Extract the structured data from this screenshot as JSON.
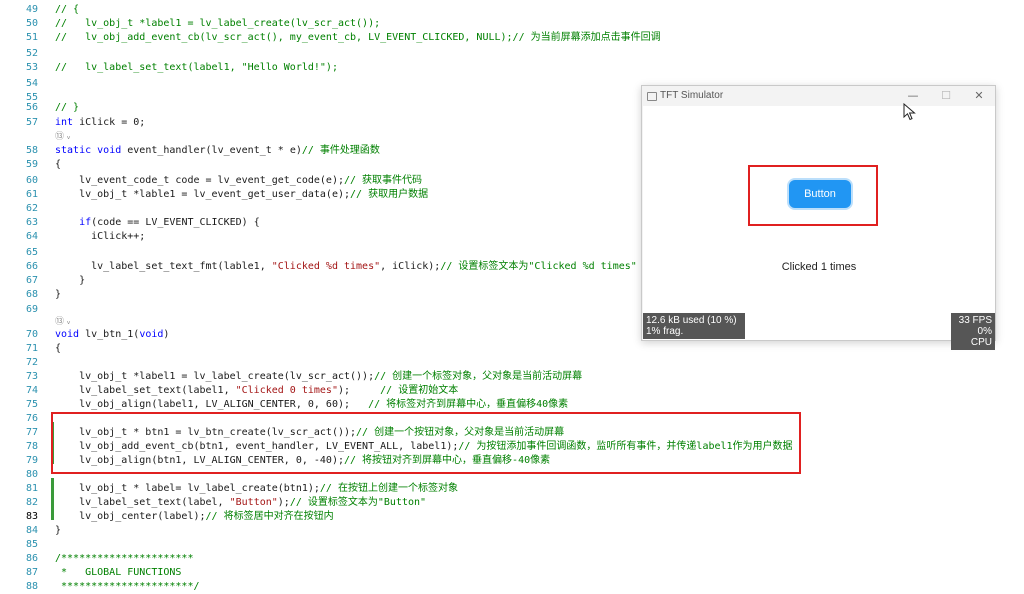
{
  "code_lines": [
    {
      "num": "49",
      "t": [
        [
          "cm",
          "// {"
        ]
      ]
    },
    {
      "num": "50",
      "t": [
        [
          "cm",
          "//   lv_obj_t *label1 = lv_label_create(lv_scr_act());"
        ]
      ]
    },
    {
      "num": "51",
      "t": [
        [
          "cm",
          "//   lv_obj_add_event_cb(lv_scr_act(), my_event_cb, LV_EVENT_CLICKED, NULL);// 为当前屏幕添加点击事件回调"
        ]
      ]
    },
    {
      "num": "52",
      "t": []
    },
    {
      "num": "53",
      "t": [
        [
          "cm",
          "//   lv_label_set_text(label1, \"Hello World!\");"
        ]
      ]
    },
    {
      "num": "54",
      "t": []
    },
    {
      "num": "55",
      "t": []
    },
    {
      "num": "56",
      "t": [
        [
          "cm",
          "// }"
        ]
      ]
    },
    {
      "num": "57",
      "t": [
        [
          "kw",
          "int"
        ],
        [
          "tx",
          " iClick = 0;"
        ]
      ]
    },
    {
      "num": "",
      "hint": "⑬ ᵥ"
    },
    {
      "num": "58",
      "t": [
        [
          "kw",
          "static"
        ],
        [
          "tx",
          " "
        ],
        [
          "kw",
          "void"
        ],
        [
          "tx",
          " event_handler(lv_event_t * e)"
        ],
        [
          "cm",
          "// 事件处理函数"
        ]
      ]
    },
    {
      "num": "59",
      "t": [
        [
          "tx",
          "{"
        ]
      ]
    },
    {
      "num": "60",
      "t": [
        [
          "tx",
          "    lv_event_code_t code = lv_event_get_code(e);"
        ],
        [
          "cm",
          "// 获取事件代码"
        ]
      ]
    },
    {
      "num": "61",
      "t": [
        [
          "tx",
          "    lv_obj_t *lable1 = lv_event_get_user_data(e);"
        ],
        [
          "cm",
          "// 获取用户数据"
        ]
      ]
    },
    {
      "num": "62",
      "t": []
    },
    {
      "num": "63",
      "t": [
        [
          "tx",
          "    "
        ],
        [
          "kw",
          "if"
        ],
        [
          "tx",
          "(code == LV_EVENT_CLICKED) {"
        ]
      ]
    },
    {
      "num": "64",
      "t": [
        [
          "tx",
          "      iClick++;"
        ]
      ]
    },
    {
      "num": "65",
      "t": []
    },
    {
      "num": "66",
      "t": [
        [
          "tx",
          "      lv_label_set_text_fmt(lable1, "
        ],
        [
          "st",
          "\"Clicked %d times\""
        ],
        [
          "tx",
          ", iClick);"
        ],
        [
          "cm",
          "// 设置标签文本为\"Clicked %d times\""
        ]
      ]
    },
    {
      "num": "67",
      "t": [
        [
          "tx",
          "    }"
        ]
      ]
    },
    {
      "num": "68",
      "t": [
        [
          "tx",
          "}"
        ]
      ]
    },
    {
      "num": "69",
      "t": []
    },
    {
      "num": "",
      "hint": "⑬ ᵥ"
    },
    {
      "num": "70",
      "t": [
        [
          "kw",
          "void"
        ],
        [
          "tx",
          " lv_btn_1("
        ],
        [
          "kw",
          "void"
        ],
        [
          "tx",
          ")"
        ]
      ]
    },
    {
      "num": "71",
      "t": [
        [
          "tx",
          "{"
        ]
      ]
    },
    {
      "num": "72",
      "t": []
    },
    {
      "num": "73",
      "t": [
        [
          "tx",
          "    lv_obj_t *label1 = lv_label_create(lv_scr_act());"
        ],
        [
          "cm",
          "// 创建一个标签对象，父对象是当前活动屏幕"
        ]
      ]
    },
    {
      "num": "74",
      "t": [
        [
          "tx",
          "    lv_label_set_text(label1, "
        ],
        [
          "st",
          "\"Clicked 0 times\""
        ],
        [
          "tx",
          ");     "
        ],
        [
          "cm",
          "// 设置初始文本"
        ]
      ]
    },
    {
      "num": "75",
      "t": [
        [
          "tx",
          "    lv_obj_align(label1, LV_ALIGN_CENTER, 0, 60);   "
        ],
        [
          "cm",
          "// 将标签对齐到屏幕中心，垂直偏移40像素"
        ]
      ]
    },
    {
      "num": "76",
      "t": []
    },
    {
      "num": "77",
      "t": [
        [
          "tx",
          "    lv_obj_t * btn1 = lv_btn_create(lv_scr_act());"
        ],
        [
          "cm",
          "// 创建一个按钮对象，父对象是当前活动屏幕"
        ]
      ]
    },
    {
      "num": "78",
      "t": [
        [
          "tx",
          "    lv_obj_add_event_cb(btn1, event_handler, LV_EVENT_ALL, label1);"
        ],
        [
          "cm",
          "// 为按钮添加事件回调函数，监听所有事件，并传递label1作为用户数据"
        ]
      ]
    },
    {
      "num": "79",
      "t": [
        [
          "tx",
          "    lv_obj_align(btn1, LV_ALIGN_CENTER, 0, -40);"
        ],
        [
          "cm",
          "// 将按钮对齐到屏幕中心，垂直偏移-40像素"
        ]
      ]
    },
    {
      "num": "80",
      "t": []
    },
    {
      "num": "81",
      "t": [
        [
          "tx",
          "    lv_obj_t * label= lv_label_create(btn1);"
        ],
        [
          "cm",
          "// 在按钮上创建一个标签对象"
        ]
      ]
    },
    {
      "num": "82",
      "t": [
        [
          "tx",
          "    lv_label_set_text(label, "
        ],
        [
          "st",
          "\"Button\""
        ],
        [
          "tx",
          ");"
        ],
        [
          "cm",
          "// 设置标签文本为\"Button\""
        ]
      ]
    },
    {
      "num": "83",
      "t": [
        [
          "tx",
          "    lv_obj_center(label);"
        ],
        [
          "cm",
          "// 将标签居中对齐在按钮内"
        ]
      ]
    },
    {
      "num": "84",
      "t": [
        [
          "tx",
          "}"
        ]
      ]
    },
    {
      "num": "85",
      "t": []
    },
    {
      "num": "86",
      "t": [
        [
          "cm",
          "/**********************"
        ]
      ]
    },
    {
      "num": "87",
      "t": [
        [
          "cm",
          " *   GLOBAL FUNCTIONS"
        ]
      ]
    },
    {
      "num": "88",
      "t": [
        [
          "cm",
          " **********************/"
        ]
      ]
    }
  ],
  "active_line": "83",
  "simulator": {
    "title": "TFT Simulator",
    "minimize": "—",
    "maximize": "☐",
    "close": "✕",
    "button_label": "Button",
    "status_label": "Clicked 1 times",
    "memory_line1": "12.6 kB used (10 %)",
    "memory_line2": "1% frag.",
    "perf_line1": "33 FPS",
    "perf_line2": "0% CPU"
  },
  "colors": {
    "highlight_box": "#e02020",
    "lv_button": "#2196f3",
    "monitor_bg": "#565656"
  }
}
